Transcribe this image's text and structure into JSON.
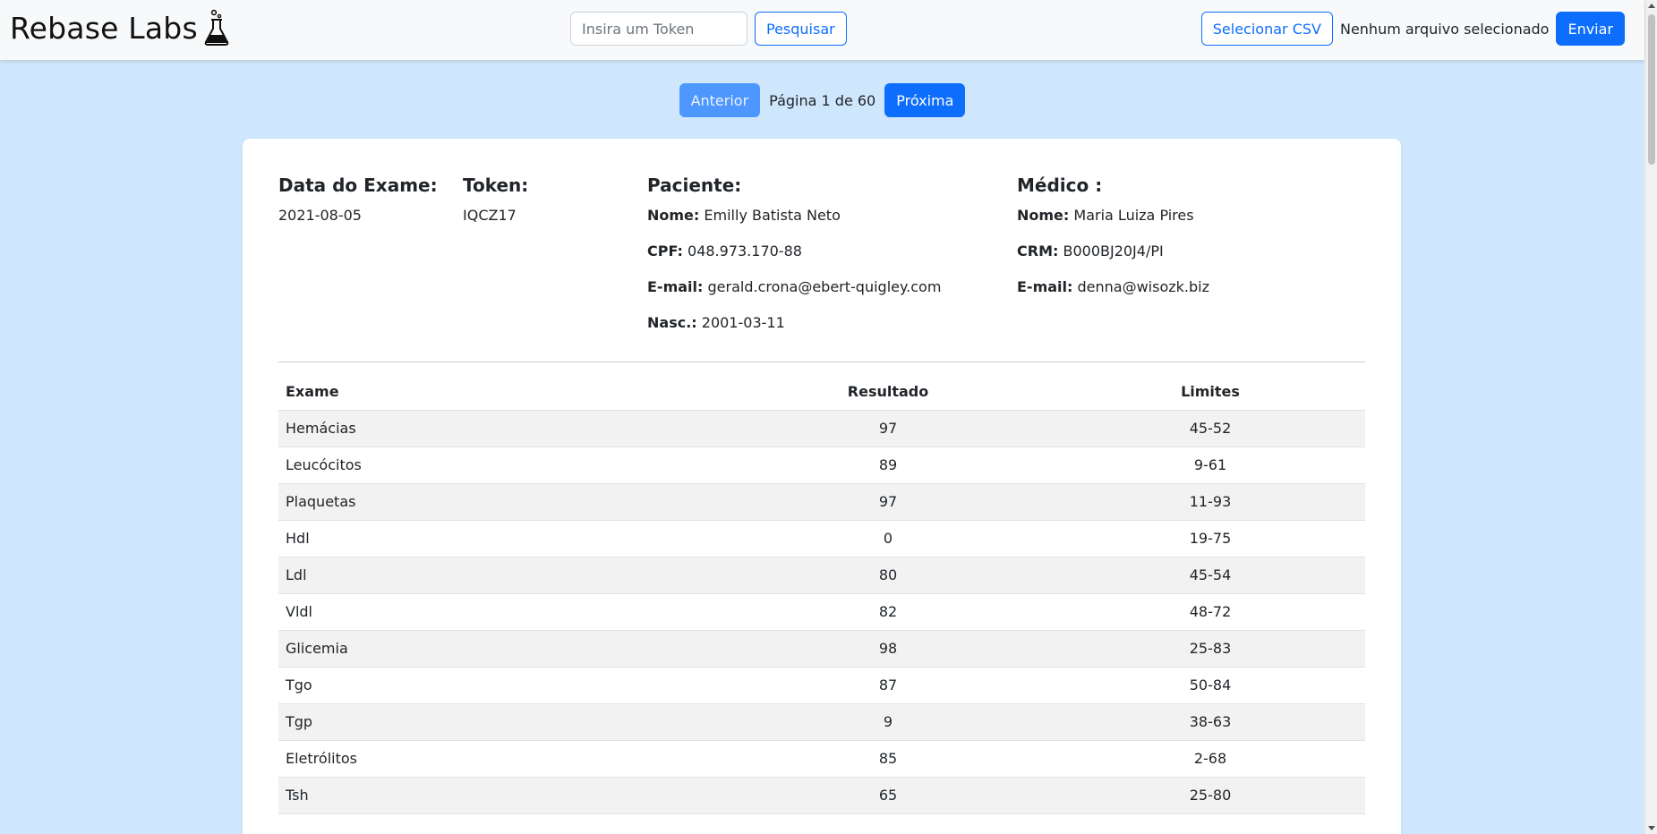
{
  "navbar": {
    "brand": "Rebase Labs",
    "brand_icon": "flask-icon",
    "search_placeholder": "Insira um Token",
    "search_label": "Pesquisar",
    "select_csv_label": "Selecionar CSV",
    "file_status": "Nenhum arquivo selecionado",
    "send_label": "Enviar"
  },
  "pagination": {
    "prev_label": "Anterior",
    "page_info": "Página 1 de 60",
    "next_label": "Próxima"
  },
  "exam": {
    "date_heading": "Data do Exame:",
    "date": "2021-08-05",
    "token_heading": "Token:",
    "token": "IQCZ17",
    "patient": {
      "heading": "Paciente:",
      "name_label": "Nome:",
      "name": "Emilly Batista Neto",
      "cpf_label": "CPF:",
      "cpf": "048.973.170-88",
      "email_label": "E-mail:",
      "email": "gerald.crona@ebert-quigley.com",
      "birth_label": "Nasc.:",
      "birth": "2001-03-11"
    },
    "doctor": {
      "heading": "Médico :",
      "name_label": "Nome:",
      "name": "Maria Luiza Pires",
      "crm_label": "CRM:",
      "crm": "B000BJ20J4/PI",
      "email_label": "E-mail:",
      "email": "denna@wisozk.biz"
    }
  },
  "table": {
    "headers": [
      "Exame",
      "Resultado",
      "Limites"
    ],
    "rows": [
      {
        "exam": "Hemácias",
        "result": "97",
        "limits": "45-52"
      },
      {
        "exam": "Leucócitos",
        "result": "89",
        "limits": "9-61"
      },
      {
        "exam": "Plaquetas",
        "result": "97",
        "limits": "11-93"
      },
      {
        "exam": "Hdl",
        "result": "0",
        "limits": "19-75"
      },
      {
        "exam": "Ldl",
        "result": "80",
        "limits": "45-54"
      },
      {
        "exam": "Vldl",
        "result": "82",
        "limits": "48-72"
      },
      {
        "exam": "Glicemia",
        "result": "98",
        "limits": "25-83"
      },
      {
        "exam": "Tgo",
        "result": "87",
        "limits": "50-84"
      },
      {
        "exam": "Tgp",
        "result": "9",
        "limits": "38-63"
      },
      {
        "exam": "Eletrólitos",
        "result": "85",
        "limits": "2-68"
      },
      {
        "exam": "Tsh",
        "result": "65",
        "limits": "25-80"
      }
    ]
  }
}
